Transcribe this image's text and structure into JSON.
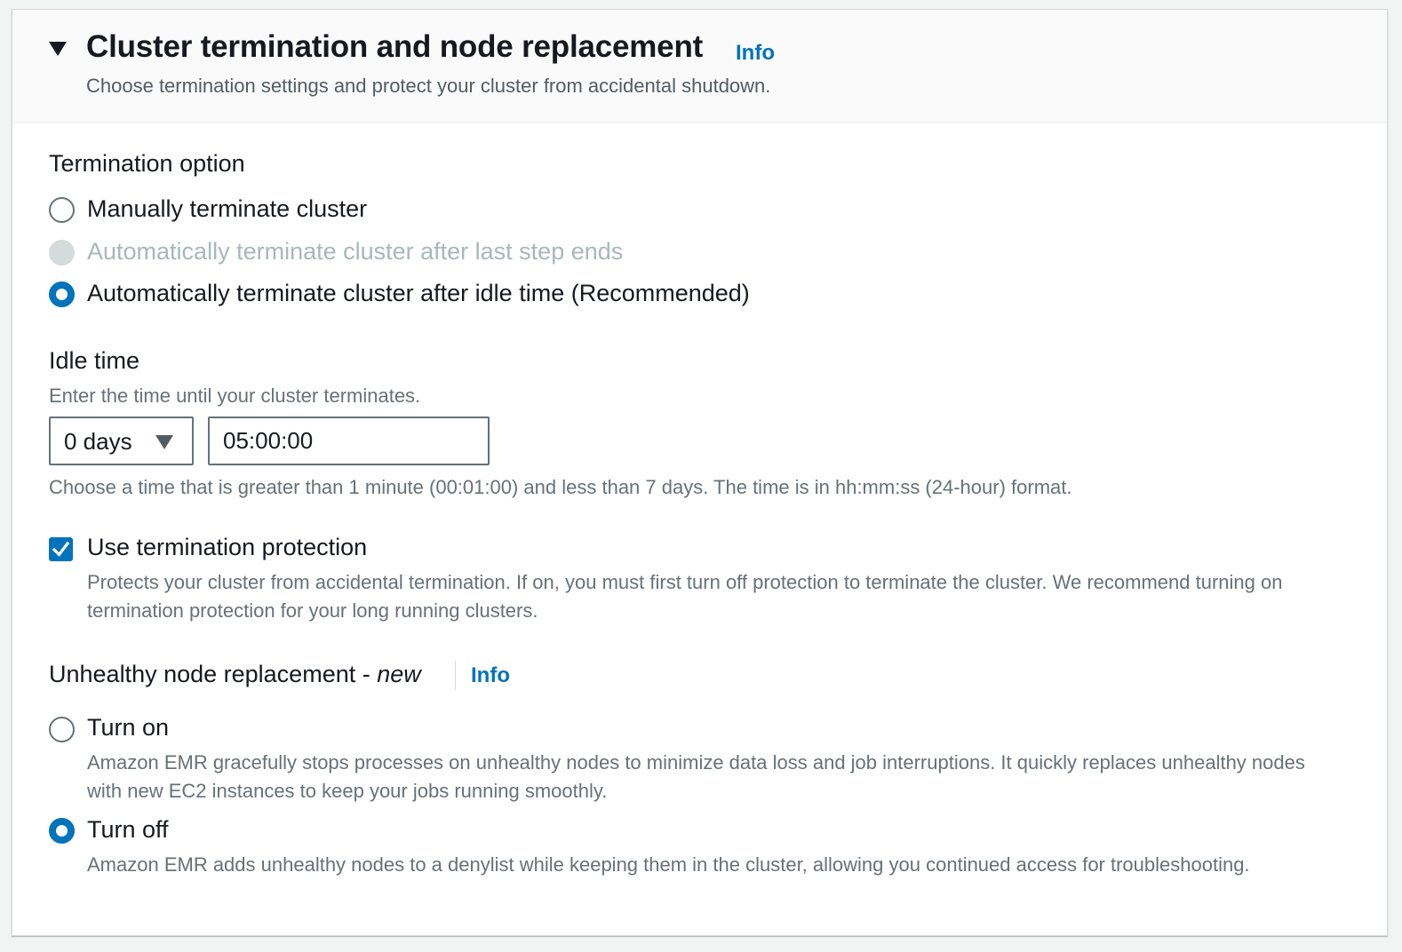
{
  "header": {
    "title": "Cluster termination and node replacement",
    "info_label": "Info",
    "description": "Choose termination settings and protect your cluster from accidental shutdown."
  },
  "termination": {
    "label": "Termination option",
    "options": [
      {
        "label": "Manually terminate cluster",
        "state": "unselected"
      },
      {
        "label": "Automatically terminate cluster after last step ends",
        "state": "disabled"
      },
      {
        "label": "Automatically terminate cluster after idle time (Recommended)",
        "state": "selected"
      }
    ]
  },
  "idle_time": {
    "label": "Idle time",
    "description": "Enter the time until your cluster terminates.",
    "days_value": "0 days",
    "time_value": "05:00:00",
    "hint": "Choose a time that is greater than 1 minute (00:01:00) and less than 7 days. The time is in hh:mm:ss (24-hour) format."
  },
  "protection": {
    "label": "Use termination protection",
    "checked": true,
    "description": "Protects your cluster from accidental termination. If on, you must first turn off protection to terminate the cluster. We recommend turning on termination protection for your long running clusters."
  },
  "unhealthy": {
    "label": "Unhealthy node replacement - ",
    "label_suffix": "new",
    "info_label": "Info",
    "options": [
      {
        "label": "Turn on",
        "state": "unselected",
        "description": "Amazon EMR gracefully stops processes on unhealthy nodes to minimize data loss and job interruptions. It quickly replaces unhealthy nodes with new EC2 instances to keep your jobs running smoothly."
      },
      {
        "label": "Turn off",
        "state": "selected",
        "description": "Amazon EMR adds unhealthy nodes to a denylist while keeping them in the cluster, allowing you continued access for troubleshooting."
      }
    ]
  },
  "colors": {
    "accent": "#0073bb",
    "text": "#16191f",
    "muted": "#687078",
    "disabled": "#aab7b8"
  }
}
